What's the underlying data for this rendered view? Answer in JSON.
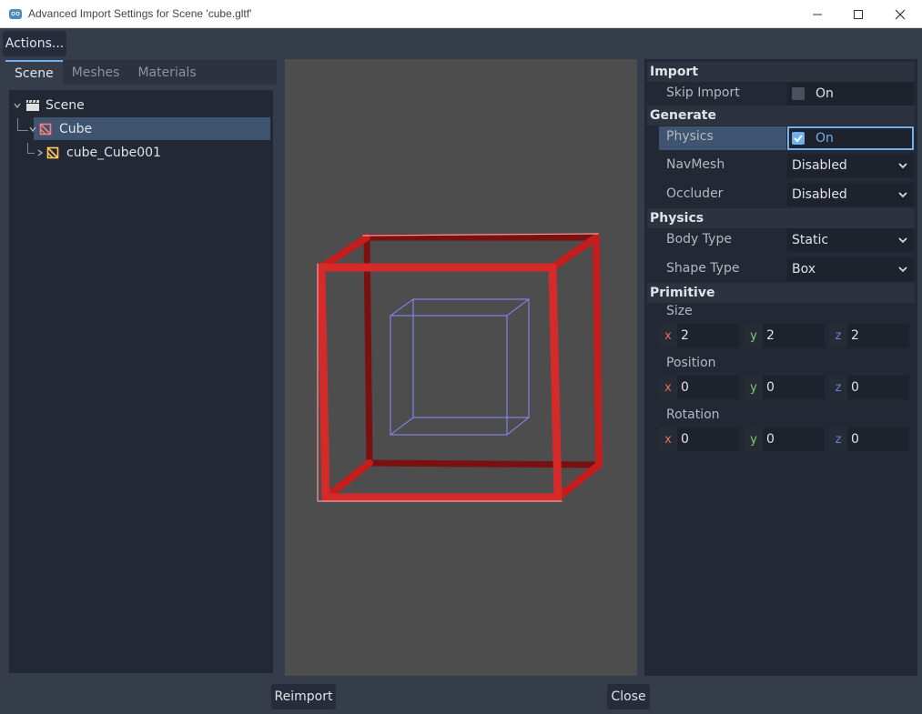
{
  "window": {
    "title": "Advanced Import Settings for Scene 'cube.gltf'",
    "app_icon": "godot-icon",
    "controls": [
      "minimize-icon",
      "maximize-icon",
      "close-icon"
    ]
  },
  "toolbar": {
    "actions_label": "Actions..."
  },
  "left_tabs": [
    {
      "label": "Scene",
      "active": true
    },
    {
      "label": "Meshes",
      "active": false
    },
    {
      "label": "Materials",
      "active": false
    }
  ],
  "tree": {
    "root": {
      "label": "Scene",
      "icon": "clapperboard-icon"
    },
    "items": [
      {
        "label": "Cube",
        "icon": "mesh-instance-icon",
        "selected": true
      },
      {
        "label": "cube_Cube001",
        "icon": "mesh-icon",
        "selected": false
      }
    ]
  },
  "inspector": {
    "sections": {
      "import": "Import",
      "generate": "Generate",
      "physics": "Physics",
      "primitive": "Primitive"
    },
    "skip_import": {
      "label": "Skip Import",
      "value": "On",
      "checked": false
    },
    "physics": {
      "label": "Physics",
      "value": "On",
      "checked": true
    },
    "navmesh": {
      "label": "NavMesh",
      "value": "Disabled"
    },
    "occluder": {
      "label": "Occluder",
      "value": "Disabled"
    },
    "body_type": {
      "label": "Body Type",
      "value": "Static"
    },
    "shape_type": {
      "label": "Shape Type",
      "value": "Box"
    },
    "size": {
      "label": "Size",
      "x": "2",
      "y": "2",
      "z": "2"
    },
    "position": {
      "label": "Position",
      "x": "0",
      "y": "0",
      "z": "0"
    },
    "rotation": {
      "label": "Rotation",
      "x": "0",
      "y": "0",
      "z": "0"
    },
    "axis_labels": {
      "x": "x",
      "y": "y",
      "z": "z"
    }
  },
  "footer": {
    "reimport_label": "Reimport",
    "close_label": "Close"
  },
  "colors": {
    "accent": "#6fb0ed",
    "selection": "#3e5470",
    "collision_shape": "#d42a2a",
    "mesh_wireframe": "#8a8aff"
  }
}
